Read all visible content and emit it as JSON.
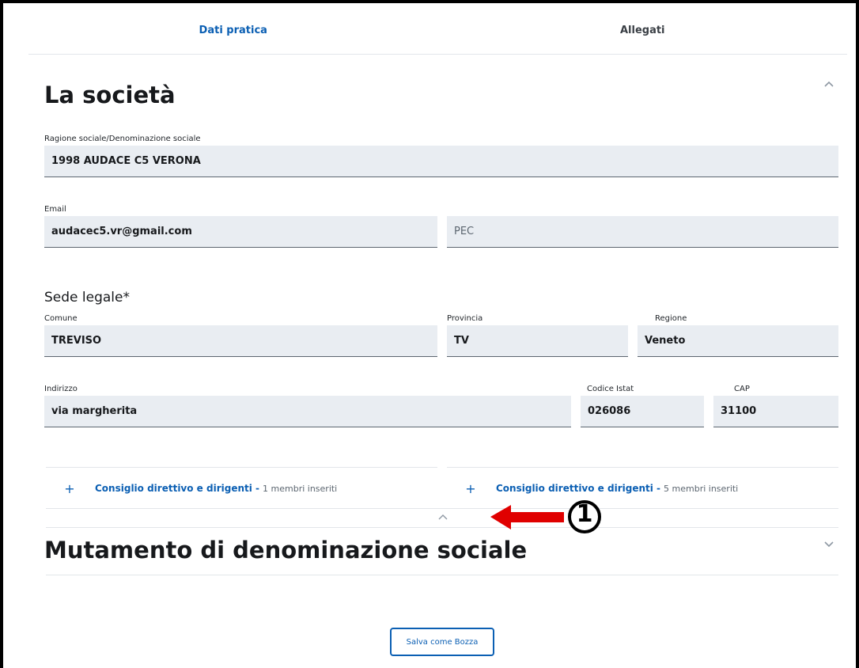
{
  "tabs": [
    {
      "label": "Dati pratica",
      "active": true
    },
    {
      "label": "Allegati",
      "active": false
    }
  ],
  "section1": {
    "title": "La società",
    "ragione_label": "Ragione sociale/Denominazione sociale",
    "ragione_value": "1998 AUDACE C5 VERONA",
    "email_label": "Email",
    "email_value": "audacec5.vr@gmail.com",
    "pec_placeholder": "PEC",
    "sede_title": "Sede legale*",
    "comune_label": "Comune",
    "comune_value": "TREVISO",
    "provincia_label": "Provincia",
    "provincia_value": "TV",
    "regione_label": "Regione",
    "regione_value": "Veneto",
    "indirizzo_label": "Indirizzo",
    "indirizzo_value": "via margherita",
    "istat_label": "Codice Istat",
    "istat_value": "026086",
    "cap_label": "CAP",
    "cap_value": "31100"
  },
  "accordions": [
    {
      "label": "Consiglio direttivo e dirigenti -",
      "count": "1 membri inseriti"
    },
    {
      "label": "Consiglio direttivo e dirigenti -",
      "count": "5 membri inseriti"
    }
  ],
  "section2": {
    "title": "Mutamento di denominazione sociale"
  },
  "save_button": "Salva come Bozza",
  "annotation": {
    "number": "1",
    "color": "#e00000"
  },
  "colors": {
    "accent": "#0b5fb3",
    "field_bg": "#e9edf2"
  }
}
